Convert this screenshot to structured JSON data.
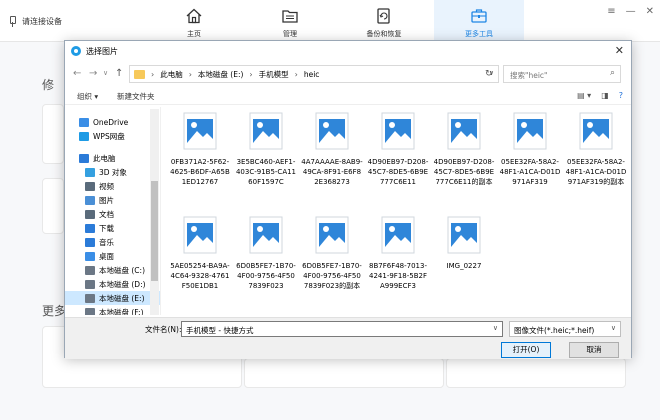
{
  "app": {
    "device_status": "请连接设备",
    "nav": [
      {
        "label": "主页",
        "icon": "home-icon"
      },
      {
        "label": "管理",
        "icon": "folder-icon"
      },
      {
        "label": "备份和恢复",
        "icon": "backup-icon"
      },
      {
        "label": "更多工具",
        "icon": "toolbox-icon"
      }
    ],
    "window_controls": [
      "≡",
      "—",
      "✕"
    ],
    "side_text_1": "修",
    "side_text_2": "更多",
    "accent": "#1e86e5"
  },
  "dialog": {
    "title": "选择图片",
    "close": "✕",
    "back": "←",
    "forward": "→",
    "up_dropdown": "∨",
    "up": "↑",
    "breadcrumb": [
      "此电脑",
      "本地磁盘 (E:)",
      "手机模型",
      "heic"
    ],
    "breadcrumb_sep": "›",
    "refresh": "↻",
    "search_placeholder": "搜索\"heic\"",
    "toolbar": {
      "organize": "组织 ▾",
      "new_folder": "新建文件夹"
    },
    "nav_pane": [
      {
        "label": "OneDrive",
        "icon": "onedrive-icon",
        "color": "#3a8ee6"
      },
      {
        "label": "WPS网盘",
        "icon": "cloud-icon",
        "color": "#1e9be5"
      },
      {
        "label": "此电脑",
        "icon": "pc-icon",
        "color": "#2b7bd8"
      },
      {
        "label": "3D 对象",
        "icon": "cube-icon",
        "color": "#34a0e0"
      },
      {
        "label": "视频",
        "icon": "video-icon",
        "color": "#5a6b7b"
      },
      {
        "label": "图片",
        "icon": "picture-icon",
        "color": "#4a8fd6"
      },
      {
        "label": "文档",
        "icon": "document-icon",
        "color": "#5a6b7b"
      },
      {
        "label": "下载",
        "icon": "download-icon",
        "color": "#2b7bd8"
      },
      {
        "label": "音乐",
        "icon": "music-icon",
        "color": "#2b7bd8"
      },
      {
        "label": "桌面",
        "icon": "desktop-icon",
        "color": "#3a8ee6"
      },
      {
        "label": "本地磁盘 (C:)",
        "icon": "drive-icon",
        "color": "#6b7785"
      },
      {
        "label": "本地磁盘 (D:)",
        "icon": "drive-icon",
        "color": "#6b7785"
      },
      {
        "label": "本地磁盘 (E:)",
        "icon": "drive-icon",
        "color": "#6b7785",
        "selected": true
      },
      {
        "label": "本地磁盘 (F:)",
        "icon": "drive-icon",
        "color": "#6b7785"
      }
    ],
    "files": [
      "0FB371A2-5F62-4625-B6DF-A65B1ED12767",
      "3E5BC460-AEF1-403C-91B5-CA1160F1597C",
      "4A7AAAAE-8AB9-49CA-8F91-E6F82E368273",
      "4D90EB97-D208-45C7-8DE5-6B9E777C6E11",
      "4D90EB97-D208-45C7-8DE5-6B9E777C6E11的副本",
      "05EE32FA-58A2-48F1-A1CA-D01D971AF319",
      "05EE32FA-58A2-48F1-A1CA-D01D971AF319的副本",
      "5AE05254-BA9A-4C64-9328-4761F50E1DB1",
      "6D0B5FE7-1B70-4F00-9756-4F507839F023",
      "6D0B5FE7-1B70-4F00-9756-4F507839F023的副本",
      "8B7F6F48-7013-4241-9F18-5B2FA999ECF3",
      "IMG_0227"
    ],
    "filename_label": "文件名(N):",
    "filename_value": "手机模型 - 快捷方式",
    "filetype": "图像文件(*.heic;*.heif)",
    "open": "打开(O)",
    "cancel": "取消"
  }
}
